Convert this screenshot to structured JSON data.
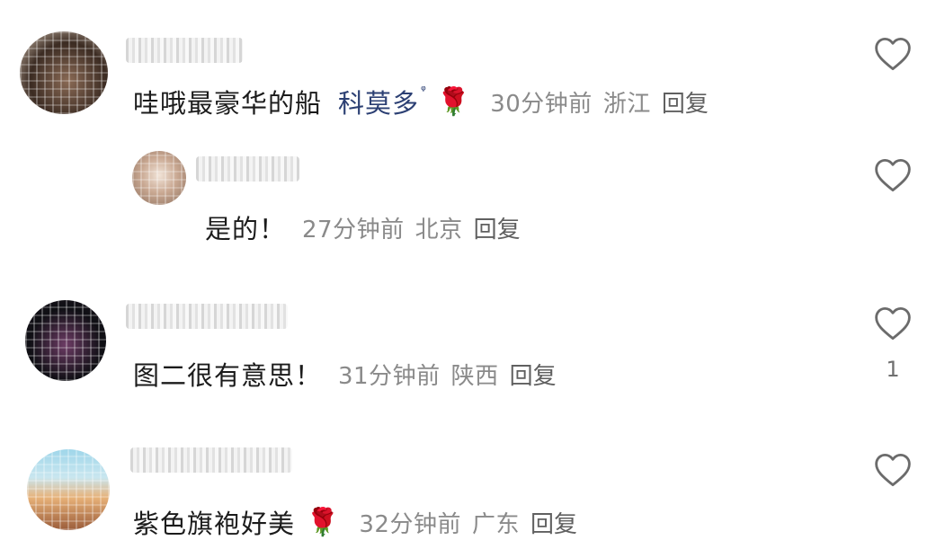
{
  "comments": [
    {
      "text": "哇哦最豪华的船",
      "mention": "科莫多",
      "mention_symbol": "ᵠ",
      "emoji": "🌹",
      "time": "30分钟前",
      "location": "浙江",
      "reply_label": "回复",
      "avatar_colors": [
        "#3b2b22",
        "#8a6a55",
        "#d9c9b8"
      ]
    },
    {
      "text": "是的！",
      "time": "27分钟前",
      "location": "北京",
      "reply_label": "回复",
      "is_reply": true,
      "avatar_colors": [
        "#c9a892",
        "#8b6e5c",
        "#f1e4d8"
      ]
    },
    {
      "text": "图二很有意思！",
      "time": "31分钟前",
      "location": "陕西",
      "reply_label": "回复",
      "like_count": "1",
      "avatar_colors": [
        "#0f0f14",
        "#6d3c65",
        "#d7a8cf"
      ]
    },
    {
      "text": "紫色旗袍好美",
      "emoji": "🌹",
      "time": "32分钟前",
      "location": "广东",
      "reply_label": "回复",
      "avatar_colors": [
        "#9fd6ea",
        "#e7b178",
        "#9a5c3a"
      ]
    }
  ],
  "icons": {
    "like": "heart-outline-icon"
  },
  "colors": {
    "text": "#1b1b1b",
    "meta": "#8a8a8a",
    "mention": "#2b3f73",
    "icon": "#6b6b6b"
  }
}
